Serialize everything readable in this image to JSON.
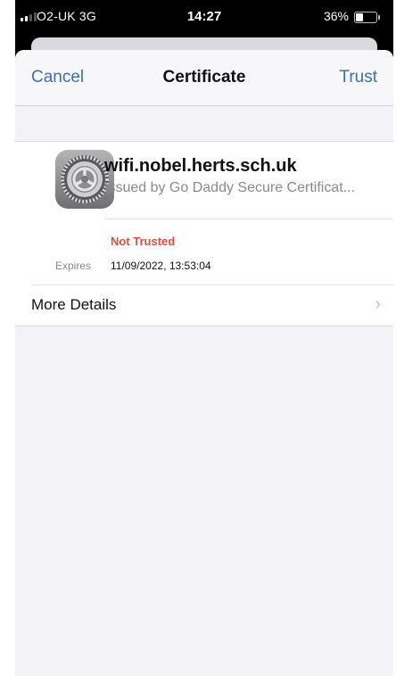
{
  "status_bar": {
    "carrier": "O2-UK",
    "network": "3G",
    "time": "14:27",
    "battery_percent": "36%",
    "battery_level": 0.36,
    "signal_bars": 2
  },
  "navbar": {
    "cancel_label": "Cancel",
    "title": "Certificate",
    "trust_label": "Trust"
  },
  "certificate": {
    "icon": "settings-gear-icon",
    "name": "wifi.nobel.herts.sch.uk",
    "issuer": "Issued by Go Daddy Secure Certificat...",
    "status": "Not Trusted",
    "status_color": "#e04a3f",
    "expires_label": "Expires",
    "expires_value": "11/09/2022, 13:53:04"
  },
  "more_details": {
    "label": "More Details",
    "chevron": "chevron-right-icon"
  },
  "colors": {
    "accent": "#3a6fb8",
    "background": "#f2f2f7"
  }
}
